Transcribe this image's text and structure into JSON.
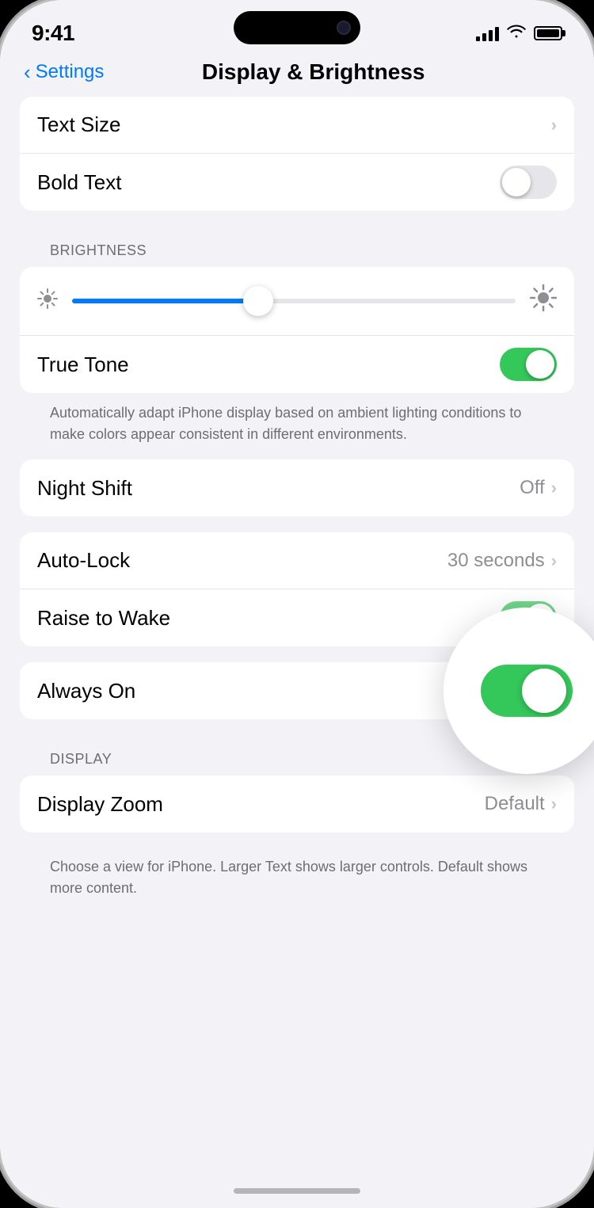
{
  "status_bar": {
    "time": "9:41",
    "signal_label": "signal",
    "wifi_label": "wifi",
    "battery_label": "battery"
  },
  "nav": {
    "back_label": "Settings",
    "title": "Display & Brightness"
  },
  "text_section": {
    "rows": [
      {
        "label": "Text Size",
        "value": "",
        "type": "chevron"
      },
      {
        "label": "Bold Text",
        "value": "",
        "type": "toggle",
        "toggle_state": "off"
      }
    ]
  },
  "brightness_section": {
    "header": "BRIGHTNESS",
    "slider_percent": 42,
    "rows": [
      {
        "label": "True Tone",
        "type": "toggle",
        "toggle_state": "on"
      }
    ],
    "footer": "Automatically adapt iPhone display based on ambient lighting conditions to make colors appear consistent in different environments."
  },
  "night_shift_section": {
    "rows": [
      {
        "label": "Night Shift",
        "value": "Off",
        "type": "chevron-value"
      }
    ]
  },
  "lock_section": {
    "rows": [
      {
        "label": "Auto-Lock",
        "value": "30 seconds",
        "type": "chevron-value"
      },
      {
        "label": "Raise to Wake",
        "type": "toggle",
        "toggle_state": "on"
      }
    ]
  },
  "always_on_section": {
    "rows": [
      {
        "label": "Always On",
        "type": "toggle",
        "toggle_state": "on",
        "magnified": true
      }
    ]
  },
  "display_section": {
    "header": "DISPLAY",
    "rows": [
      {
        "label": "Display Zoom",
        "value": "Default",
        "type": "chevron-value"
      }
    ],
    "footer": "Choose a view for iPhone. Larger Text shows larger controls. Default shows more content."
  },
  "icons": {
    "back_chevron": "‹",
    "chevron_right": "›",
    "sun_small": "☀",
    "sun_large": "☀"
  }
}
